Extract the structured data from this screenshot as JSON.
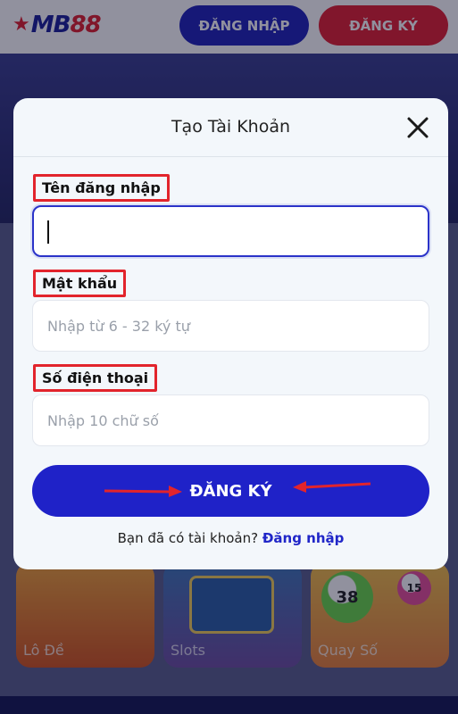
{
  "header": {
    "logo_prefix": "★",
    "logo_text": "MB",
    "logo_accent": "88",
    "login_label": "ĐĂNG NHẬP",
    "register_label": "ĐĂNG KÝ"
  },
  "tiles": [
    {
      "label": "Lô Đề"
    },
    {
      "label": "Slots"
    },
    {
      "label": "Quay Số"
    }
  ],
  "balls": [
    "38",
    "15"
  ],
  "modal": {
    "title": "Tạo Tài Khoản",
    "fields": {
      "username": {
        "label": "Tên đăng nhập",
        "value": "",
        "placeholder": ""
      },
      "password": {
        "label": "Mật khẩu",
        "value": "",
        "placeholder": "Nhập từ 6 - 32 ký tự"
      },
      "phone": {
        "label": "Số điện thoại",
        "value": "",
        "placeholder": "Nhập 10 chữ số"
      }
    },
    "submit_label": "ĐĂNG KÝ",
    "footer_text": "Bạn đã có tài khoản? ",
    "footer_link": "Đăng nhập"
  },
  "colors": {
    "primary_blue": "#1f22c8",
    "brand_red": "#e21f31",
    "annotation_red": "#e2242c"
  },
  "icons": [
    "star-icon",
    "close-icon",
    "red-arrow-right-icon",
    "red-arrow-left-icon"
  ]
}
